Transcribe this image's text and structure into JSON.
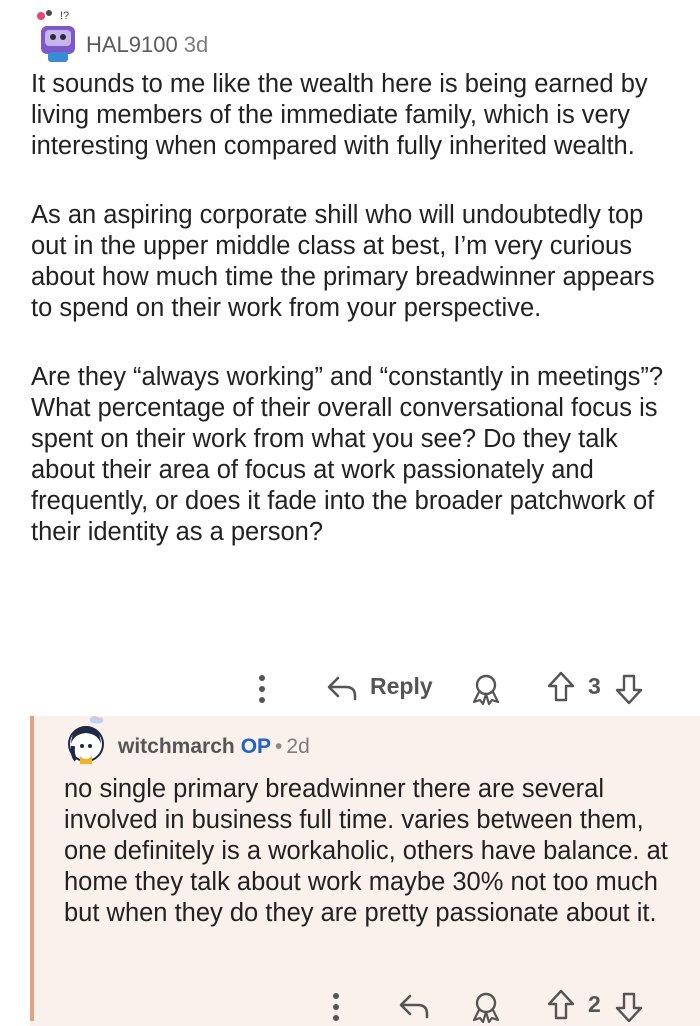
{
  "comment": {
    "author": "HAL9100",
    "age": "3d",
    "paragraphs": [
      "It sounds to me like the wealth here is being earned by living members of the immediate family, which is very interesting when compared with fully inherited wealth.",
      "As an aspiring corporate shill who will undoubtedly top out in the upper middle class at best, I’m very curious about how much time the primary breadwinner appears to spend on their work from your perspective.",
      "Are they “always working” and “constantly in meetings”? What percentage of their overall conversational focus is spent on their work from what you see? Do they talk about their area of focus at work passionately and frequently, or does it fade into the broader patchwork of their identity as a person?"
    ],
    "actions": {
      "more_icon": "more-vertical-icon",
      "reply_icon": "reply-arrow-icon",
      "reply_label": "Reply",
      "award_icon": "award-icon",
      "upvote_icon": "upvote-arrow-icon",
      "vote_count": "3",
      "downvote_icon": "downvote-arrow-icon"
    }
  },
  "reply": {
    "author": "witchmarch",
    "badge": "OP",
    "separator": "•",
    "age": "2d",
    "text": "no single primary breadwinner there are several involved in business full time. varies between them, one definitely is a workaholic, others have balance. at home they talk about work maybe 30% not too much but when they do they are pretty passionate about it.",
    "actions": {
      "vote_count": "2"
    }
  },
  "colors": {
    "reply_background": "#fbf1ec",
    "thread_line": "#e6a184",
    "op_badge": "#1d63c9",
    "action_grey": "#555555"
  }
}
